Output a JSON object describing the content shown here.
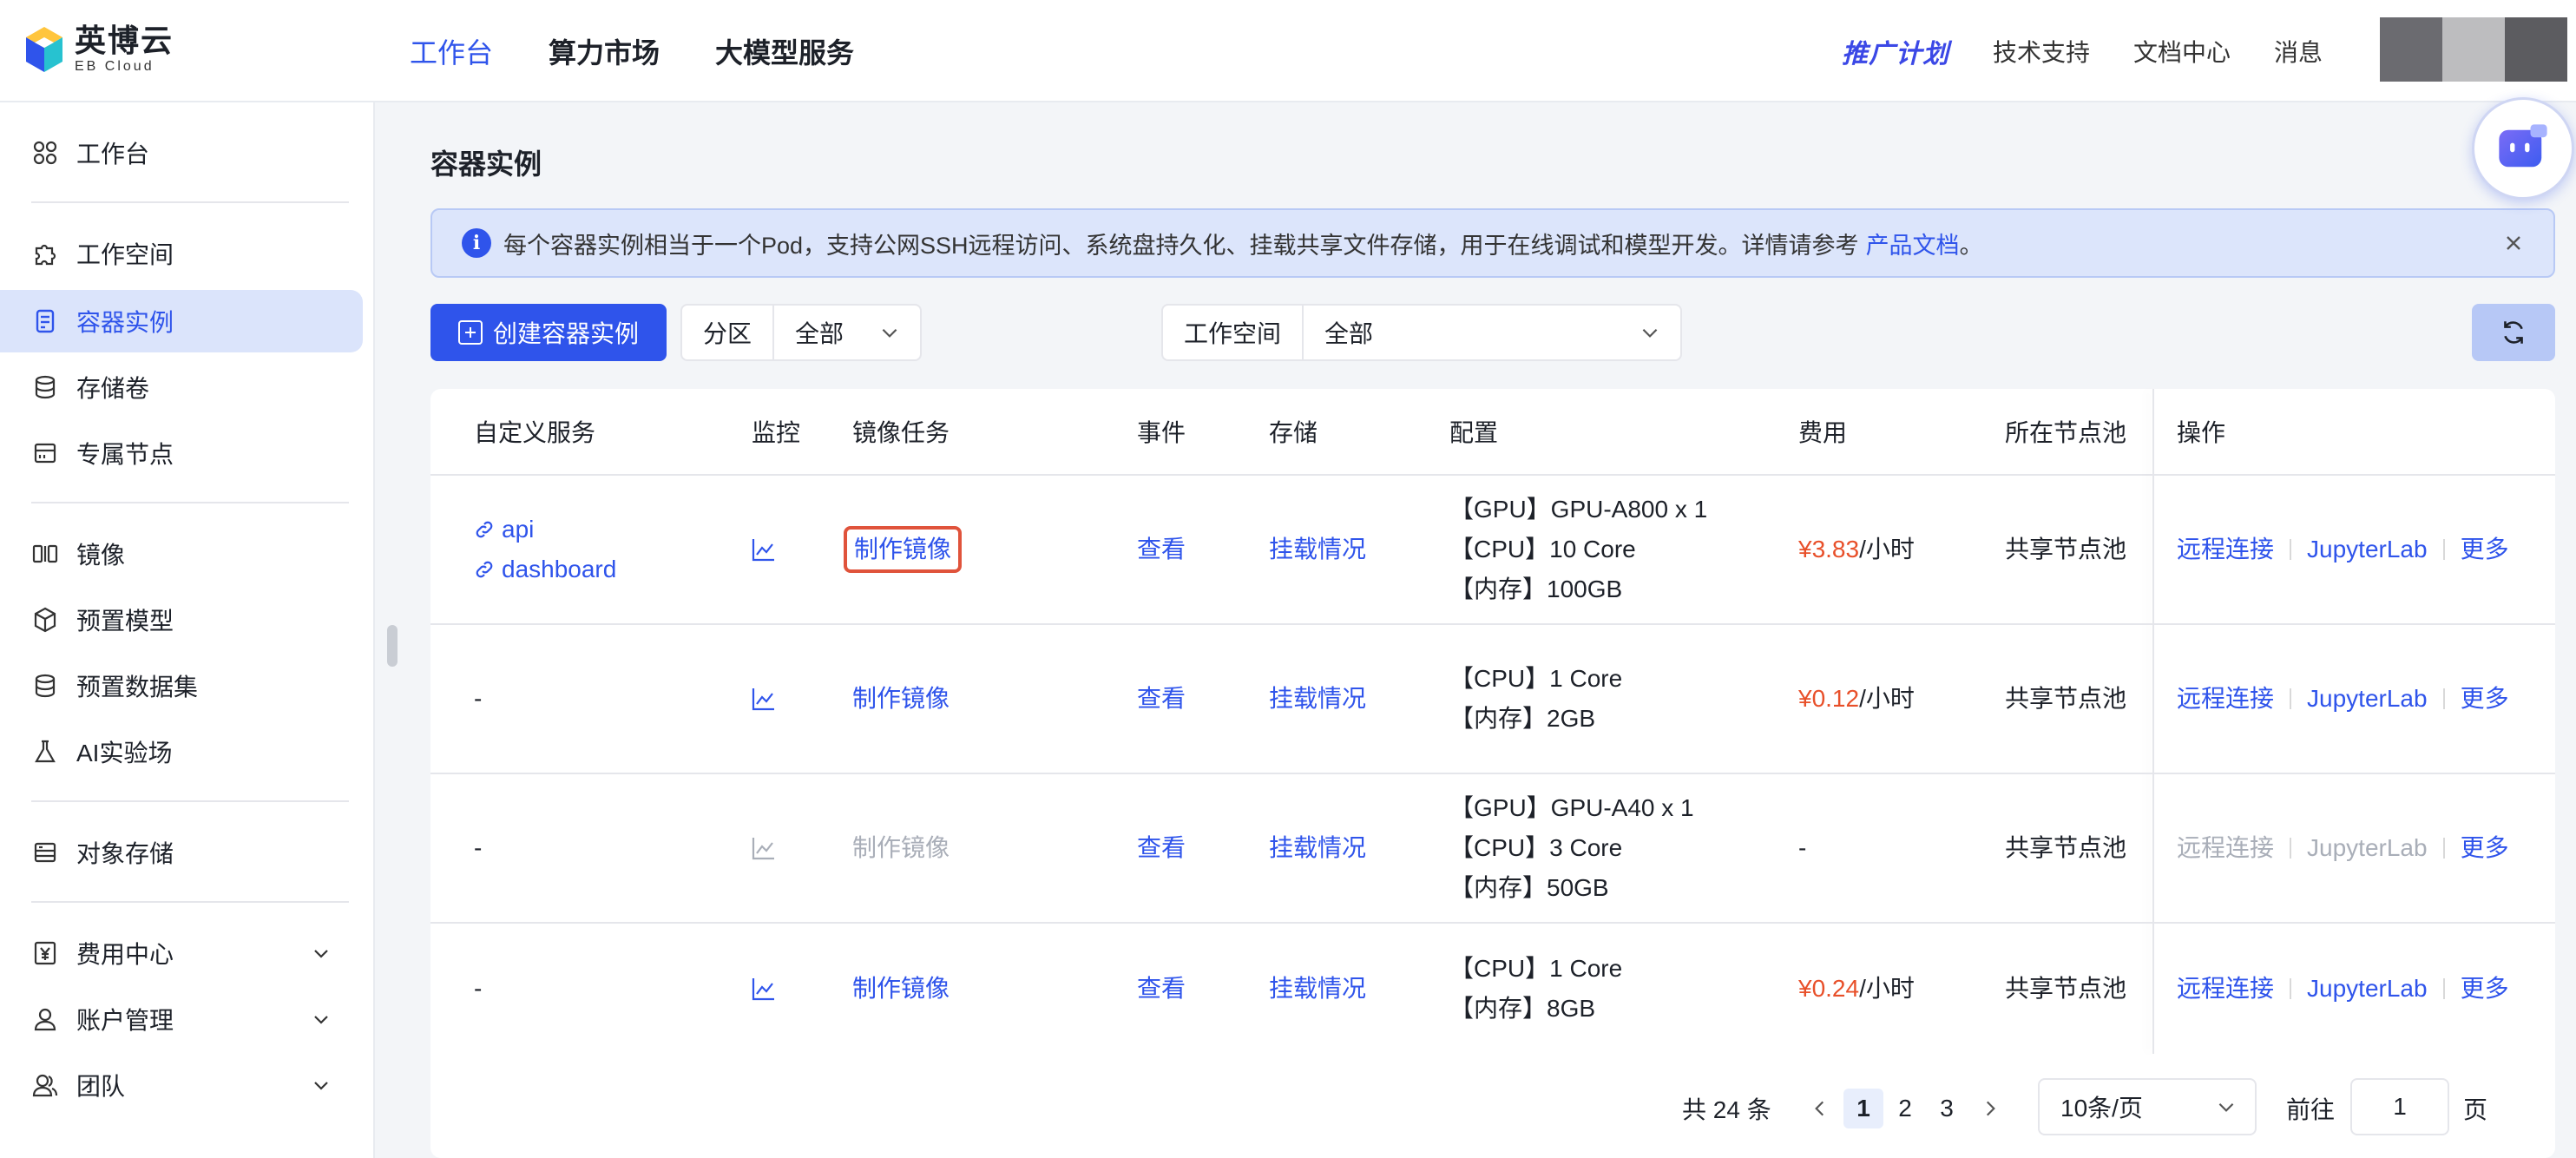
{
  "brand": {
    "name_cn": "英博云",
    "name_en": "EB Cloud"
  },
  "top_nav": [
    "工作台",
    "算力市场",
    "大模型服务"
  ],
  "top_right": {
    "promo": "推广计划",
    "links": [
      "技术支持",
      "文档中心",
      "消息"
    ]
  },
  "sidebar": {
    "items": [
      {
        "label": "工作台",
        "icon": "apps-icon"
      },
      {
        "label": "工作空间",
        "icon": "puzzle-icon"
      },
      {
        "label": "容器实例",
        "icon": "container-icon",
        "active": true
      },
      {
        "label": "存储卷",
        "icon": "database-icon"
      },
      {
        "label": "专属节点",
        "icon": "server-icon"
      },
      {
        "label": "镜像",
        "icon": "image-icon"
      },
      {
        "label": "预置模型",
        "icon": "cube-icon"
      },
      {
        "label": "预置数据集",
        "icon": "dataset-icon"
      },
      {
        "label": "AI实验场",
        "icon": "flask-icon"
      },
      {
        "label": "对象存储",
        "icon": "bucket-icon"
      },
      {
        "label": "费用中心",
        "icon": "yen-icon",
        "expandable": true
      },
      {
        "label": "账户管理",
        "icon": "user-icon",
        "expandable": true
      },
      {
        "label": "团队",
        "icon": "team-icon",
        "expandable": true
      }
    ]
  },
  "page": {
    "title": "容器实例"
  },
  "alert": {
    "text": "每个容器实例相当于一个Pod，支持公网SSH远程访问、系统盘持久化、挂载共享文件存储，用于在线调试和模型开发。详情请参考",
    "link": "产品文档",
    "suffix": "。"
  },
  "toolbar": {
    "create_label": "创建容器实例",
    "partition_label": "分区",
    "partition_value": "全部",
    "workspace_label": "工作空间",
    "workspace_value": "全部"
  },
  "table": {
    "headers": [
      "自定义服务",
      "监控",
      "镜像任务",
      "事件",
      "存储",
      "配置",
      "费用",
      "所在节点池",
      "操作"
    ],
    "rows": [
      {
        "services": [
          "api",
          "dashboard"
        ],
        "image_task": "制作镜像",
        "image_task_enabled": true,
        "event": "查看",
        "storage": "挂载情况",
        "config": [
          "【GPU】GPU-A800 x 1",
          "【CPU】10 Core",
          "【内存】100GB"
        ],
        "price": "¥3.83",
        "unit": " /小时",
        "pool": "共享节点池",
        "ops": [
          "远程连接",
          "JupyterLab",
          "更多"
        ],
        "ops_enabled": true
      },
      {
        "services": [
          "-"
        ],
        "image_task": "制作镜像",
        "image_task_enabled": true,
        "event": "查看",
        "storage": "挂载情况",
        "config": [
          "【CPU】1 Core",
          "【内存】2GB"
        ],
        "price": "¥0.12",
        "unit": " /小时",
        "pool": "共享节点池",
        "ops": [
          "远程连接",
          "JupyterLab",
          "更多"
        ],
        "ops_enabled": true
      },
      {
        "services": [
          "-"
        ],
        "image_task": "制作镜像",
        "image_task_enabled": false,
        "event": "查看",
        "storage": "挂载情况",
        "config": [
          "【GPU】GPU-A40 x 1",
          "【CPU】3 Core",
          "【内存】50GB"
        ],
        "price": "-",
        "unit": "",
        "pool": "共享节点池",
        "ops": [
          "远程连接",
          "JupyterLab",
          "更多"
        ],
        "ops_enabled": false
      },
      {
        "services": [
          "-"
        ],
        "image_task": "制作镜像",
        "image_task_enabled": true,
        "event": "查看",
        "storage": "挂载情况",
        "config": [
          "【CPU】1 Core",
          "【内存】8GB"
        ],
        "price": "¥0.24",
        "unit": " /小时",
        "pool": "共享节点池",
        "ops": [
          "远程连接",
          "JupyterLab",
          "更多"
        ],
        "ops_enabled": true
      }
    ]
  },
  "pagination": {
    "total": "共 24 条",
    "pages": [
      "1",
      "2",
      "3"
    ],
    "current": "1",
    "page_size": "10条/页",
    "goto_label": "前往",
    "goto_value": "1",
    "goto_suffix": "页"
  },
  "colors": {
    "primary": "#2f54eb",
    "price": "#e8502a",
    "highlight": "#e0533b"
  }
}
